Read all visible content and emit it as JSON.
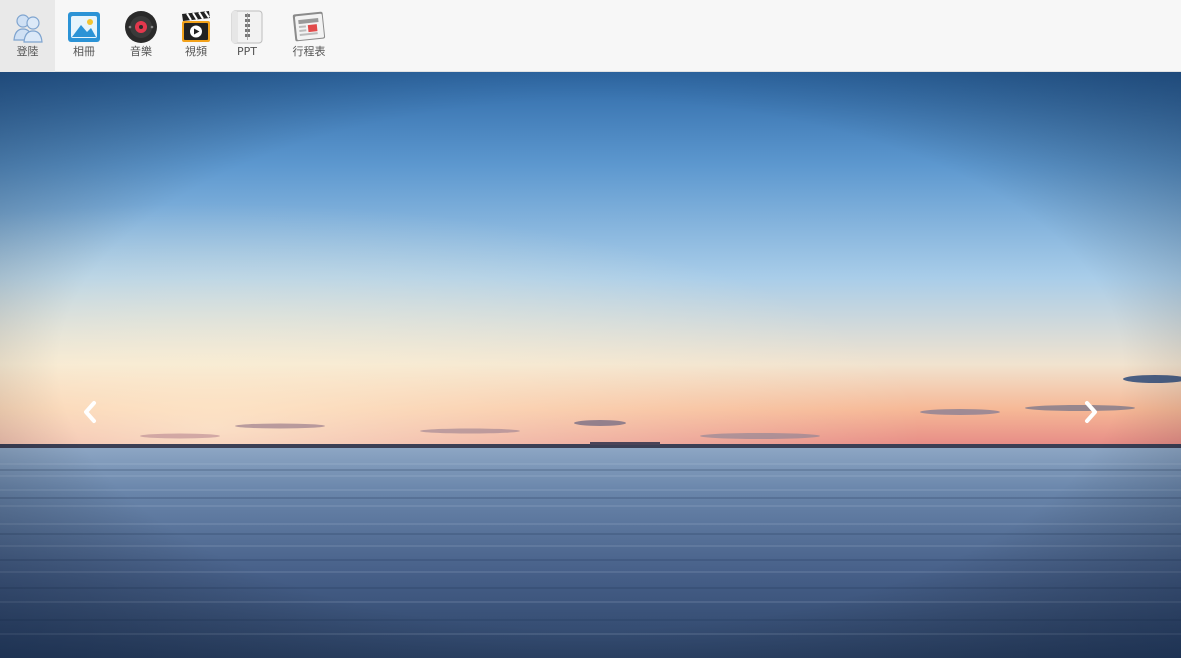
{
  "nav": {
    "items": [
      {
        "label": "登陸",
        "icon": "users-icon"
      },
      {
        "label": "相冊",
        "icon": "photo-album-icon"
      },
      {
        "label": "音樂",
        "icon": "music-icon"
      },
      {
        "label": "視頻",
        "icon": "video-clapper-icon"
      },
      {
        "label": "PPT",
        "icon": "presentation-icon"
      },
      {
        "label": "行程表",
        "icon": "calendar-icon"
      }
    ],
    "active_index": 0
  },
  "carousel": {
    "prev_icon": "chevron-left-icon",
    "next_icon": "chevron-right-icon",
    "slide": "sunset-sea-photo"
  },
  "colors": {
    "toolbar_bg": "#f7f7f7",
    "active_bg": "#e9e9e9",
    "sky_top": "#2f6fae",
    "horizon": "#f4a98a",
    "sea": "#3f5f8c"
  }
}
